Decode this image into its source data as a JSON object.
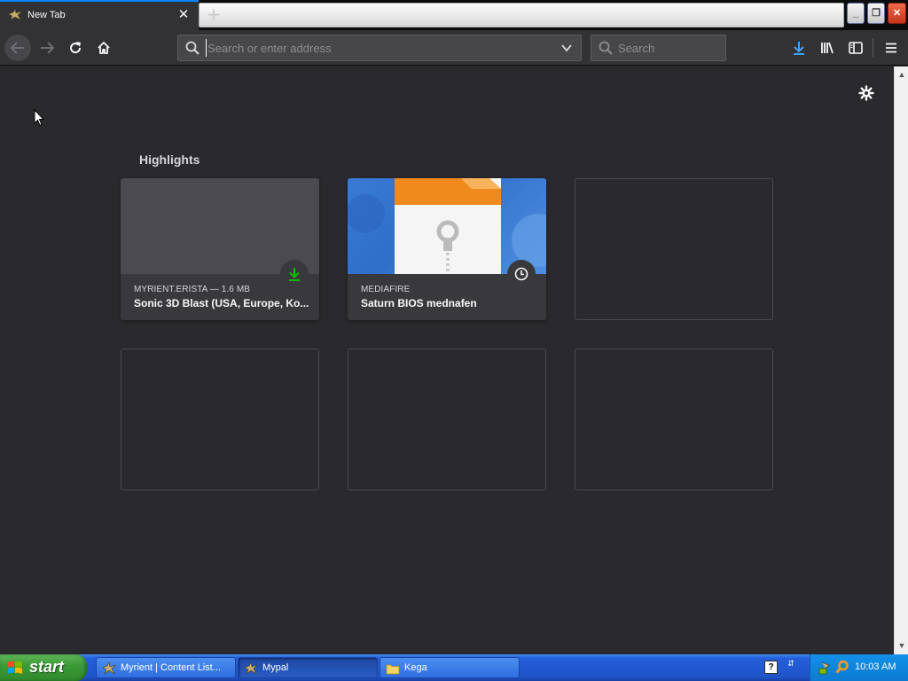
{
  "browser": {
    "tab": {
      "title": "New Tab",
      "close_glyph": "✕"
    },
    "new_tab_glyph": "+",
    "window_controls": {
      "minimize": "_",
      "maximize": "❐",
      "close": "✕"
    },
    "urlbar": {
      "placeholder": "Search or enter address",
      "value": ""
    },
    "searchbar": {
      "placeholder": "Search",
      "value": ""
    },
    "accent_color": "#0a84ff"
  },
  "newtab": {
    "section_title": "Highlights",
    "highlights": [
      {
        "source": "MYRIENT.ERISTA — 1.6 MB",
        "title": "Sonic 3D Blast (USA, Europe, Ko...",
        "badge": "download-icon",
        "badge_color": "#12bc00"
      },
      {
        "source": "MEDIAFIRE",
        "title": "Saturn BIOS mednafen",
        "badge": "clock-icon",
        "badge_color": "#f9f9fa"
      }
    ]
  },
  "taskbar": {
    "start_label": "start",
    "tasks": [
      {
        "label": "Myrient | Content List...",
        "icon": "browser-icon",
        "active": false
      },
      {
        "label": "Mypal",
        "icon": "browser-icon",
        "active": true
      },
      {
        "label": "Kega",
        "icon": "folder-icon",
        "active": false
      }
    ],
    "help_glyph": "?",
    "clock": "10:03 AM"
  }
}
